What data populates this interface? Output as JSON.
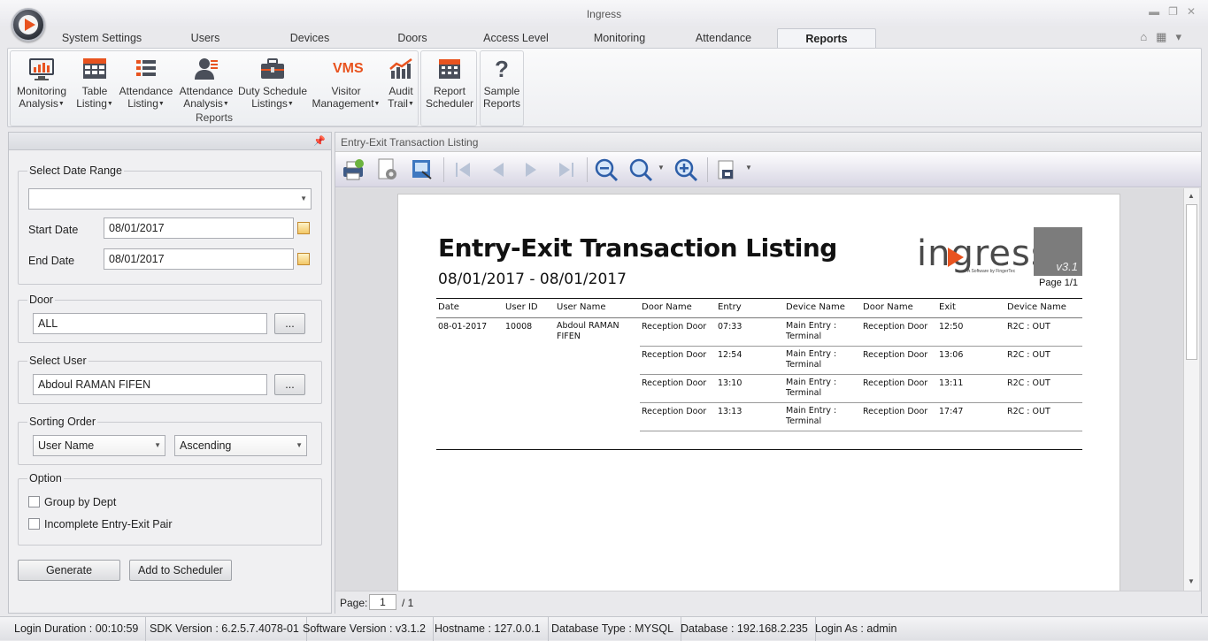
{
  "window": {
    "title": "Ingress"
  },
  "menu_tabs": [
    {
      "label": "System Settings"
    },
    {
      "label": "Users"
    },
    {
      "label": "Devices"
    },
    {
      "label": "Doors"
    },
    {
      "label": "Access Level"
    },
    {
      "label": "Monitoring"
    },
    {
      "label": "Attendance"
    },
    {
      "label": "Reports",
      "active": true
    }
  ],
  "ribbon": {
    "group_label": "Reports",
    "buttons": [
      {
        "line1": "Monitoring",
        "line2": "Analysis",
        "icon": "monitor-chart-icon",
        "dropdown": true
      },
      {
        "line1": "Table",
        "line2": "Listing",
        "icon": "table-icon",
        "dropdown": true
      },
      {
        "line1": "Attendance",
        "line2": "Listing",
        "icon": "list-icon",
        "dropdown": true
      },
      {
        "line1": "Attendance",
        "line2": "Analysis",
        "icon": "user-analysis-icon",
        "dropdown": true
      },
      {
        "line1": "Duty Schedule",
        "line2": "Listings",
        "icon": "briefcase-icon",
        "dropdown": true
      },
      {
        "line1": "Visitor",
        "line2": "Management",
        "icon": "vms-icon",
        "icon_text": "VMS",
        "dropdown": true
      },
      {
        "line1": "Audit",
        "line2": "Trail",
        "icon": "audit-chart-icon",
        "dropdown": true
      }
    ],
    "scheduler": {
      "line1": "Report",
      "line2": "Scheduler",
      "icon": "calendar-grid-icon"
    },
    "samples": {
      "line1": "Sample",
      "line2": "Reports",
      "icon": "question-icon",
      "icon_text": "?"
    }
  },
  "left_panel": {
    "date_range": {
      "legend": "Select Date Range",
      "selected": "",
      "start_label": "Start Date",
      "start_value": "08/01/2017",
      "end_label": "End Date",
      "end_value": "08/01/2017"
    },
    "door": {
      "legend": "Door",
      "value": "ALL",
      "browse_label": "..."
    },
    "user": {
      "legend": "Select User",
      "value": "Abdoul RAMAN FIFEN",
      "browse_label": "..."
    },
    "sorting": {
      "legend": "Sorting Order",
      "field": "User Name",
      "direction": "Ascending"
    },
    "option": {
      "legend": "Option",
      "group_by_dept": "Group by Dept",
      "incomplete_pair": "Incomplete Entry-Exit Pair"
    },
    "generate_label": "Generate",
    "scheduler_label": "Add to Scheduler"
  },
  "report_panel": {
    "title": "Entry-Exit Transaction Listing",
    "page_label": "Page:",
    "page_value": "1",
    "page_total": "/ 1"
  },
  "report": {
    "title": "Entry-Exit Transaction Listing",
    "range": "08/01/2017 - 08/01/2017",
    "logo": "ingress",
    "logo_sub": "A Software by FingerTec",
    "logo_version": "v3.1",
    "page": "Page 1/1",
    "columns": [
      "Date",
      "User ID",
      "User Name",
      "Door Name",
      "Entry",
      "Device Name",
      "Door Name",
      "Exit",
      "Device Name"
    ],
    "group": {
      "date": "08-01-2017",
      "user_id": "10008",
      "user_name_1": "Abdoul RAMAN",
      "user_name_2": "FIFEN"
    },
    "rows": [
      {
        "door_in": "Reception Door",
        "entry": "07:33",
        "dev_in_1": "Main Entry :",
        "dev_in_2": "Terminal",
        "door_out": "Reception Door",
        "exit": "12:50",
        "dev_out": "R2C : OUT"
      },
      {
        "door_in": "Reception Door",
        "entry": "12:54",
        "dev_in_1": "Main Entry :",
        "dev_in_2": "Terminal",
        "door_out": "Reception Door",
        "exit": "13:06",
        "dev_out": "R2C : OUT"
      },
      {
        "door_in": "Reception Door",
        "entry": "13:10",
        "dev_in_1": "Main Entry :",
        "dev_in_2": "Terminal",
        "door_out": "Reception Door",
        "exit": "13:11",
        "dev_out": "R2C : OUT"
      },
      {
        "door_in": "Reception Door",
        "entry": "13:13",
        "dev_in_1": "Main Entry :",
        "dev_in_2": "Terminal",
        "door_out": "Reception Door",
        "exit": "17:47",
        "dev_out": "R2C : OUT"
      }
    ]
  },
  "status": [
    "Login Duration : 00:10:59",
    "SDK Version : 6.2.5.7.4078-01",
    "Software Version : v3.1.2",
    "Hostname : 127.0.0.1",
    "Database Type : MYSQL",
    "Database : 192.168.2.235",
    "Login As : admin"
  ],
  "colors": {
    "accent": "#e8531f",
    "active_tab": "#f3f4f7"
  }
}
